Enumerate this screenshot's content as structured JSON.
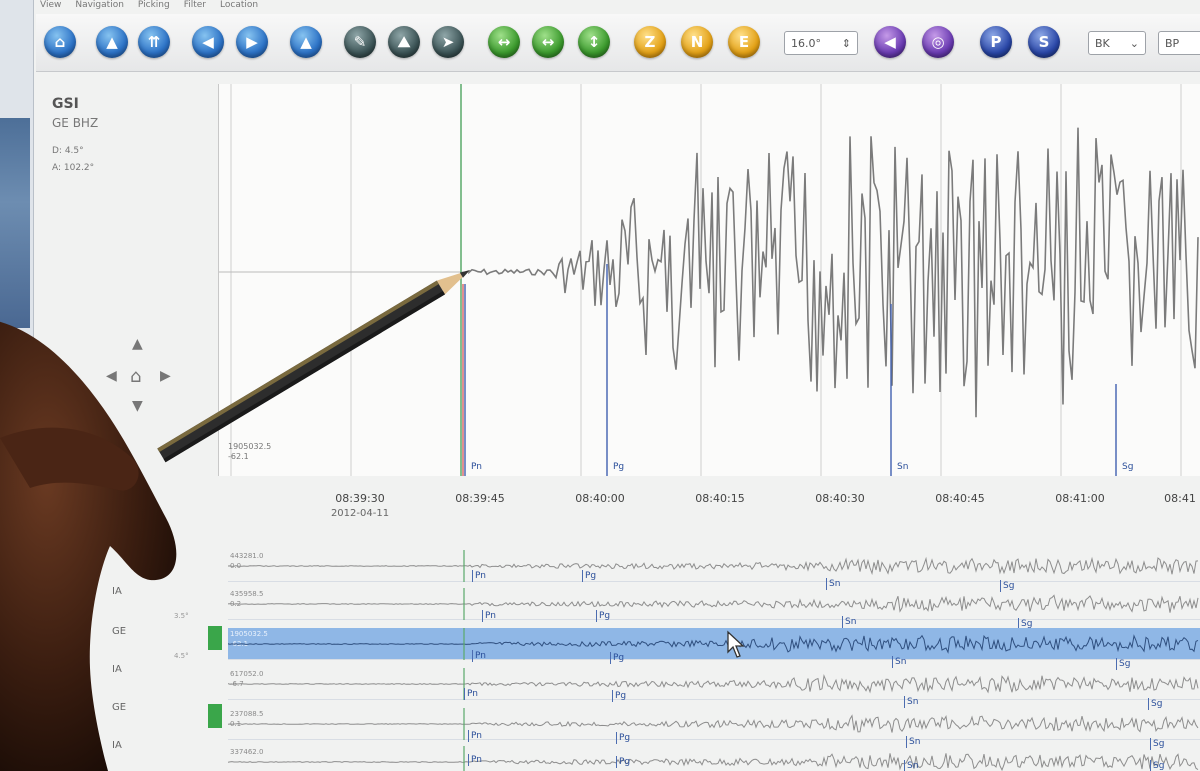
{
  "menu": [
    "View",
    "Navigation",
    "Picking",
    "Filter",
    "Location"
  ],
  "toolbar": {
    "filter_value": "16.0°",
    "component_buttons": [
      "Z",
      "N",
      "E"
    ],
    "phase_buttons": [
      "P",
      "S"
    ],
    "network_select": "BK",
    "bp_label": "BP"
  },
  "station": {
    "code": "GSI",
    "channel": "GE BHZ",
    "distance": "D: 4.5°",
    "azimuth": "A: 102.2°"
  },
  "trace": {
    "amplitude_top": "1905032.5",
    "amplitude_bottom": "-62.1",
    "time_ticks": [
      "08:39:30",
      "08:39:45",
      "08:40:00",
      "08:40:15",
      "08:40:30",
      "08:40:45",
      "08:41:00",
      "08:41"
    ],
    "date": "2012-04-11",
    "picks": [
      "Pn",
      "Pg",
      "Sn",
      "Sg"
    ]
  },
  "records": [
    {
      "name": "443281.0",
      "sub": "0.0",
      "network": "",
      "dist": "",
      "picks": [
        "Pn",
        "Pg",
        "Sn",
        "Sg"
      ]
    },
    {
      "name": "435958.5",
      "sub": "0.2",
      "network": "IA",
      "dist": "3.5°",
      "picks": [
        "Pn",
        "Pg",
        "Sn",
        "Sg"
      ]
    },
    {
      "name": "1905032.5",
      "sub": "-62.1",
      "network": "GE",
      "dist": "4.5°",
      "picks": [
        "Pn",
        "Pg",
        "Sn",
        "Sg"
      ]
    },
    {
      "name": "617052.0",
      "sub": "-6.7",
      "network": "IA",
      "dist": "",
      "picks": [
        "Pn",
        "Pg",
        "Sn",
        "Sg"
      ]
    },
    {
      "name": "237088.5",
      "sub": "0.1",
      "network": "GE",
      "dist": "",
      "picks": [
        "Pn",
        "Pg",
        "Sn",
        "Sg"
      ]
    },
    {
      "name": "337462.0",
      "sub": "",
      "network": "IA",
      "dist": "",
      "picks": [
        "Pn",
        "Pg",
        "Sn",
        "Sg"
      ]
    }
  ],
  "colors": {
    "selected_row": "#8fb7e6",
    "pick_blue": "#2b4f9a",
    "status_green": "#3aa64a"
  }
}
